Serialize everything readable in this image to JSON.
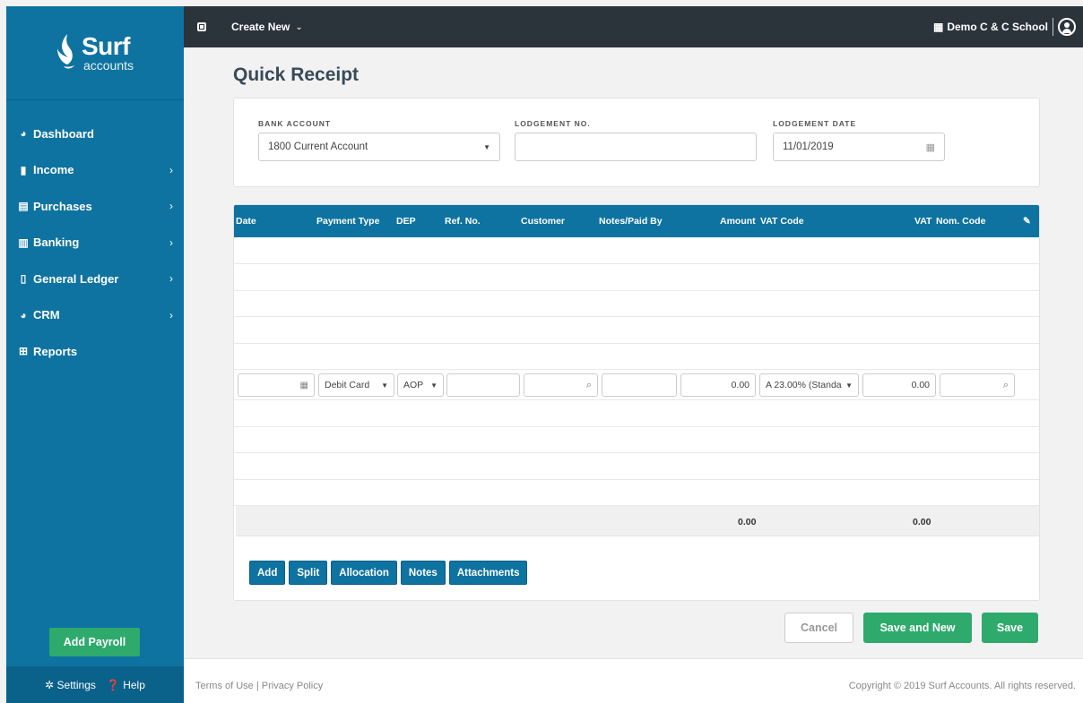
{
  "brand": {
    "name": "Surf",
    "sub": "accounts"
  },
  "sidebar": {
    "items": [
      {
        "label": "Dashboard",
        "icon": "dashboard-icon",
        "glyph": "◕",
        "chevron": ""
      },
      {
        "label": "Income",
        "icon": "briefcase-icon",
        "glyph": "▮",
        "chevron": "›"
      },
      {
        "label": "Purchases",
        "icon": "credit-card-icon",
        "glyph": "▤",
        "chevron": "›"
      },
      {
        "label": "Banking",
        "icon": "bank-icon",
        "glyph": "▥",
        "chevron": "›"
      },
      {
        "label": "General Ledger",
        "icon": "document-icon",
        "glyph": "▯",
        "chevron": "›"
      },
      {
        "label": "CRM",
        "icon": "pie-chart-icon",
        "glyph": "◕",
        "chevron": "›"
      },
      {
        "label": "Reports",
        "icon": "table-icon",
        "glyph": "⊞",
        "chevron": ""
      }
    ],
    "add_payroll": "Add Payroll",
    "settings": "Settings",
    "help": "Help"
  },
  "topbar": {
    "create_new": "Create New",
    "school": "Demo C & C School"
  },
  "page": {
    "title": "Quick Receipt"
  },
  "form": {
    "bank_account_label": "BANK ACCOUNT",
    "bank_account_value": "1800 Current Account",
    "lodgement_no_label": "LODGEMENT NO.",
    "lodgement_no_value": "",
    "lodgement_date_label": "LODGEMENT DATE",
    "lodgement_date_value": "11/01/2019"
  },
  "table": {
    "headers": {
      "date": "Date",
      "payment_type": "Payment Type",
      "dep": "DEP",
      "ref_no": "Ref. No.",
      "customer": "Customer",
      "notes": "Notes/Paid By",
      "amount": "Amount",
      "vat_code": "VAT Code",
      "vat": "VAT",
      "nom_code": "Nom. Code"
    },
    "entry": {
      "date": "",
      "payment_type": "Debit Card",
      "dep": "AOP",
      "ref_no": "",
      "customer": "",
      "notes": "",
      "amount": "0.00",
      "vat_code": "A 23.00% (Standa",
      "vat": "0.00",
      "nom_code": ""
    },
    "totals": {
      "amount": "0.00",
      "vat": "0.00"
    }
  },
  "buttons": {
    "add": "Add",
    "split": "Split",
    "allocation": "Allocation",
    "notes": "Notes",
    "attachments": "Attachments",
    "cancel": "Cancel",
    "save_and_new": "Save and New",
    "save": "Save"
  },
  "footer": {
    "terms": "Terms of Use",
    "separator": "|",
    "privacy": "Privacy Policy",
    "copyright": "Copyright © 2019 Surf Accounts. All rights reserved."
  },
  "colors": {
    "primary": "#0e73a0",
    "success": "#2eaa6d",
    "topbar": "#2b333b"
  }
}
